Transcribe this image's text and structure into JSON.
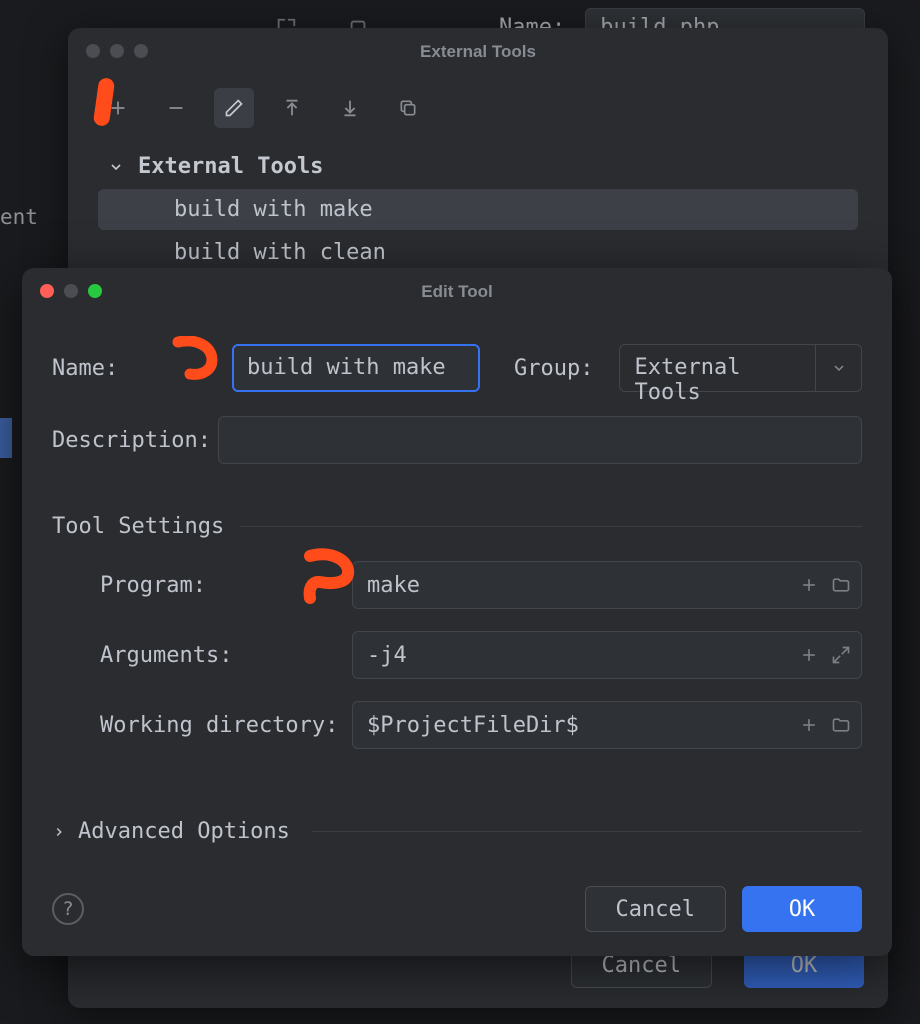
{
  "bg": {
    "sidebar_text": "ent",
    "top": {
      "name_label": "Name:",
      "name_value": "build_php"
    }
  },
  "parent_dialog": {
    "title": "External Tools",
    "tree": {
      "group_label": "External Tools",
      "items": [
        {
          "label": "build with make",
          "selected": true
        },
        {
          "label": "build with clean",
          "selected": false
        }
      ]
    },
    "footer": {
      "cancel": "Cancel",
      "ok": "OK"
    }
  },
  "child_dialog": {
    "title": "Edit Tool",
    "name_label": "Name:",
    "name_value": "build with make",
    "group_label": "Group:",
    "group_value": "External Tools",
    "description_label": "Description:",
    "description_value": "",
    "tool_settings_label": "Tool Settings",
    "program_label": "Program:",
    "program_value": "make",
    "arguments_label": "Arguments:",
    "arguments_value": "-j4",
    "working_dir_label": "Working directory:",
    "working_dir_value": "$ProjectFileDir$",
    "advanced_label": "Advanced Options",
    "footer": {
      "cancel": "Cancel",
      "ok": "OK"
    }
  }
}
